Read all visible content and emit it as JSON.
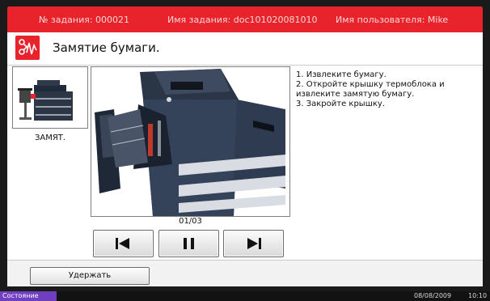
{
  "job_bar": {
    "job_number": "№ задания: 000021",
    "job_name": "Имя задания:  doc101020081010",
    "user_name": "Имя пользователя: Mike"
  },
  "message": {
    "icon": "paper-jam-icon",
    "title": "Замятие бумаги."
  },
  "location": {
    "label": "ЗАМЯТ."
  },
  "instructions": [
    "1. Извлеките бумагу.",
    "2. Откройте крышку термоблока и извлеките замятую бумагу.",
    "3. Закройте крышку."
  ],
  "pager": {
    "counter": "01/03",
    "prev_icon": "skip-back-icon",
    "pause_icon": "pause-icon",
    "next_icon": "skip-forward-icon"
  },
  "footer": {
    "hold_label": "Удержать"
  },
  "status_bar": {
    "status_label": "Состояние",
    "date": "08/08/2009",
    "time": "10:10"
  },
  "colors": {
    "accent_red": "#e8232c",
    "status_purple": "#6f3fc0"
  }
}
